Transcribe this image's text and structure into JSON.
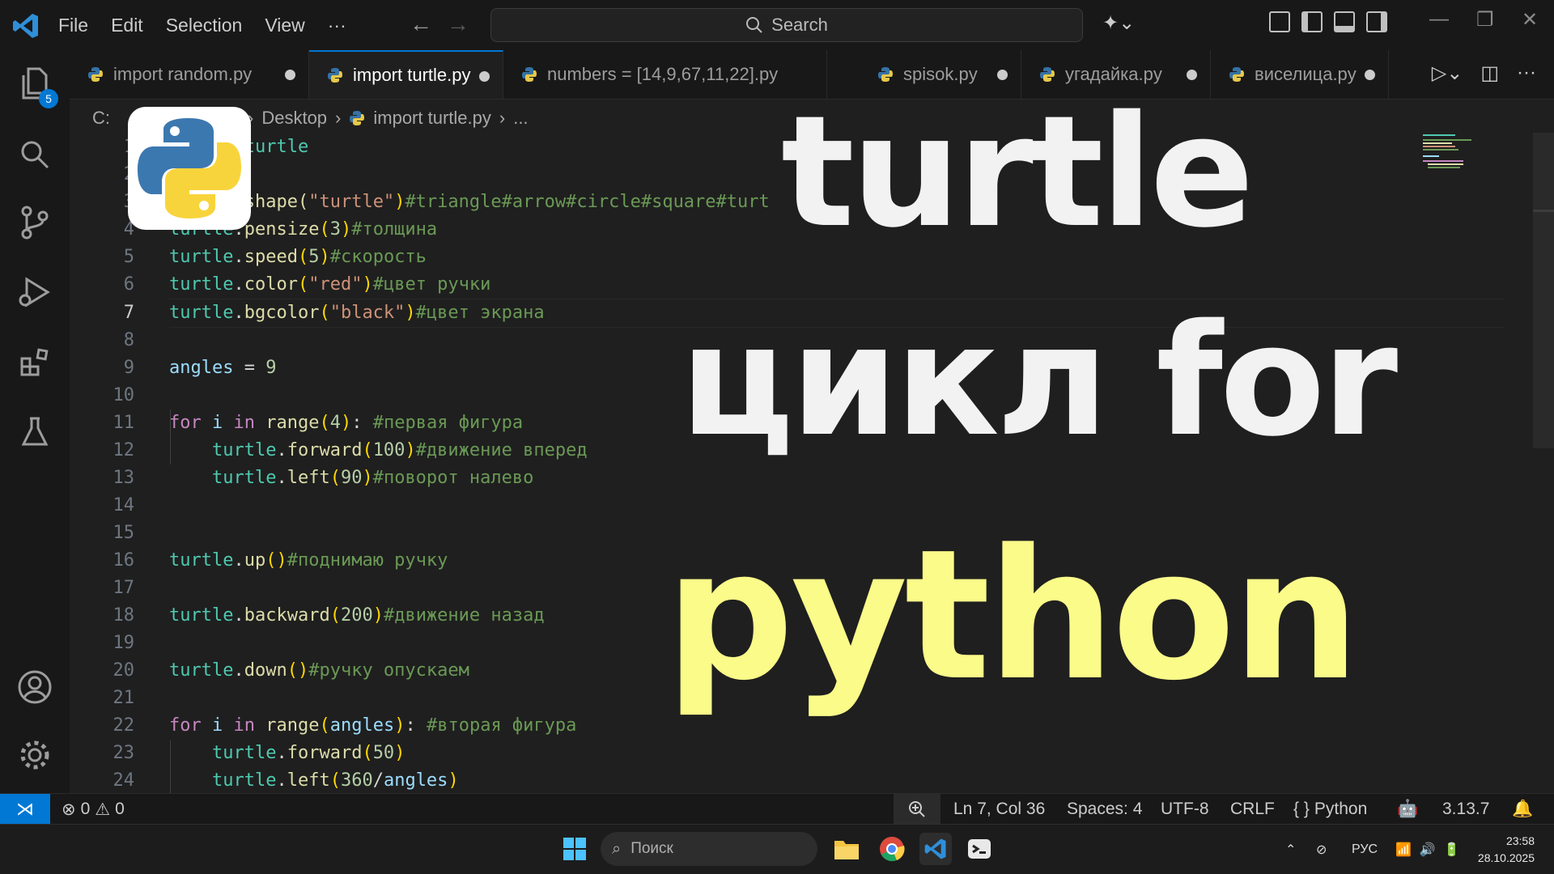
{
  "menu": {
    "file": "File",
    "edit": "Edit",
    "selection": "Selection",
    "view": "View",
    "more": "···"
  },
  "search": {
    "label": "Search"
  },
  "activity": {
    "explorer_badge": "5"
  },
  "tabs": [
    {
      "label": "import random.py",
      "dirty": true,
      "active": false
    },
    {
      "label": "import turtle.py",
      "dirty": true,
      "active": true
    },
    {
      "label": "numbers = [14,9,67,11,22].py",
      "dirty": false,
      "active": false
    },
    {
      "label": "spisok.py",
      "dirty": true,
      "active": false
    },
    {
      "label": "угадайка.py",
      "dirty": true,
      "active": false
    },
    {
      "label": "виселица.py",
      "dirty": true,
      "active": false
    }
  ],
  "breadcrumb": {
    "drive": "C:",
    "folder": "Desktop",
    "file": "import turtle.py",
    "more": "..."
  },
  "code": {
    "l1": "turtle",
    "l3a": "shape(",
    "l3s": "\"turtle\"",
    "l3b": ")",
    "l3c": "#triangle#arrow#circle#square#turt",
    "l4a": "turtle",
    "l4b": ".",
    "l4f": "pensize",
    "l4n": "3",
    "l4c": "#толщина",
    "l5a": "turtle",
    "l5f": "speed",
    "l5n": "5",
    "l5c": "#скорость",
    "l6a": "turtle",
    "l6f": "color",
    "l6s": "\"red\"",
    "l6c": "#цвет ручки",
    "l7a": "turtle",
    "l7f": "bgcolor",
    "l7s": "\"black\"",
    "l7c": "#цвет экрана",
    "l9v": "angles",
    "l9op": " = ",
    "l9n": "9",
    "l11k": "for",
    "l11v": "i",
    "l11in": "in",
    "l11f": "range",
    "l11n": "4",
    "l11c": "#первая фигура",
    "l12a": "turtle",
    "l12f": "forward",
    "l12n": "100",
    "l12c": "#движение вперед",
    "l13a": "turtle",
    "l13f": "left",
    "l13n": "90",
    "l13c": "#поворот налево",
    "l16a": "turtle",
    "l16f": "up",
    "l16c": "#поднимаю ручку",
    "l18a": "turtle",
    "l18f": "backward",
    "l18n": "200",
    "l18c": "#движение назад",
    "l20a": "turtle",
    "l20f": "down",
    "l20c": "#ручку опускаем",
    "l22k": "for",
    "l22v": "i",
    "l22in": "in",
    "l22f": "range",
    "l22arg": "angles",
    "l22c": "#вторая фигура",
    "l23a": "turtle",
    "l23f": "forward",
    "l23n": "50",
    "l24a": "turtle",
    "l24f": "left",
    "l24n": "360",
    "l24v": "angles"
  },
  "line_numbers": [
    "1",
    "2",
    "3",
    "4",
    "5",
    "6",
    "7",
    "8",
    "9",
    "10",
    "11",
    "12",
    "13",
    "14",
    "15",
    "16",
    "17",
    "18",
    "19",
    "20",
    "21",
    "22",
    "23",
    "24"
  ],
  "overlay": {
    "line1": "turtle",
    "line2": "цикл for",
    "line3": "python"
  },
  "status": {
    "errors": "0",
    "warnings": "0",
    "position": "Ln 7, Col 36",
    "spaces": "Spaces: 4",
    "encoding": "UTF-8",
    "eol": "CRLF",
    "language": "Python",
    "interpreter": "3.13.7"
  },
  "taskbar": {
    "search_placeholder": "Поиск",
    "lang": "РУС",
    "time": "23:58",
    "date": "28.10.2025"
  },
  "colors": {
    "accent": "#0078d4",
    "keyword": "#c586c0",
    "function": "#dcdcaa",
    "string": "#ce9178",
    "comment": "#6a9955",
    "number": "#b5cea8",
    "overlay_yellow": "#fbfb8a"
  }
}
